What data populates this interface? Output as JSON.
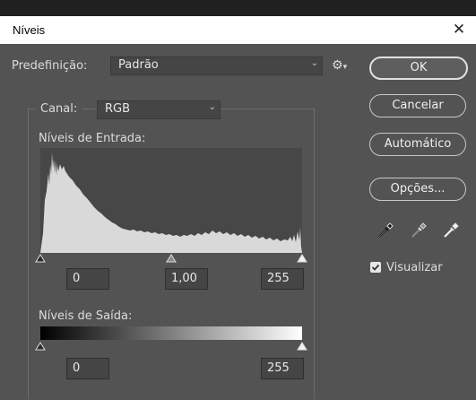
{
  "window": {
    "title": "Níveis"
  },
  "preset": {
    "label": "Predefinição:",
    "value": "Padrão"
  },
  "buttons": {
    "ok": "OK",
    "cancel": "Cancelar",
    "auto": "Automático",
    "options": "Opções..."
  },
  "channel": {
    "label": "Canal:",
    "value": "RGB"
  },
  "input_levels": {
    "label": "Níveis de Entrada:",
    "black": "0",
    "gamma": "1,00",
    "white": "255"
  },
  "output_levels": {
    "label": "Níveis de Saída:",
    "black": "0",
    "white": "255"
  },
  "preview": {
    "label": "Visualizar",
    "checked": true
  },
  "icons": [
    "gear-icon",
    "black-eyedropper-icon",
    "gray-eyedropper-icon",
    "white-eyedropper-icon",
    "close-icon",
    "chevron-down-icon"
  ]
}
